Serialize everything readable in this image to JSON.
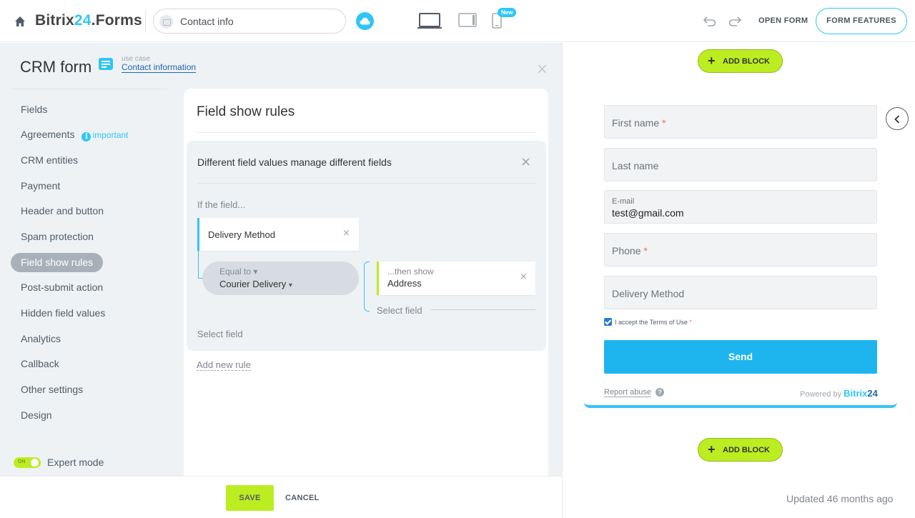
{
  "topbar": {
    "brand_main": "Bitrix",
    "brand_num": "24",
    "brand_suffix": ".Forms",
    "form_name": "Contact info",
    "new_badge": "New",
    "open_form": "OPEN FORM",
    "form_features": "FORM FEATURES"
  },
  "editor": {
    "title": "CRM form",
    "usecase_label": "use case",
    "usecase_value": "Contact information",
    "menu": [
      {
        "label": "Fields"
      },
      {
        "label": "Agreements",
        "badge": "important"
      },
      {
        "label": "CRM entities"
      },
      {
        "label": "Payment"
      },
      {
        "label": "Header and button"
      },
      {
        "label": "Spam protection"
      },
      {
        "label": "Field show rules",
        "active": true
      },
      {
        "label": "Post-submit action"
      },
      {
        "label": "Hidden field values"
      },
      {
        "label": "Analytics"
      },
      {
        "label": "Callback"
      },
      {
        "label": "Other settings"
      },
      {
        "label": "Design"
      }
    ],
    "expert_toggle_text": "ON",
    "expert_mode": "Expert mode"
  },
  "rules": {
    "title": "Field show rules",
    "rule_title": "Different field values manage different fields",
    "if_field": "If the field...",
    "field": "Delivery Method",
    "condition_label": "Equal to",
    "condition_value": "Courier Delivery",
    "then_label": "...then show",
    "then_value": "Address",
    "select_field_then": "Select field",
    "select_field": "Select field",
    "add_rule": "Add new rule"
  },
  "bottombar": {
    "save": "SAVE",
    "cancel": "CANCEL"
  },
  "preview": {
    "add_block": "ADD BLOCK",
    "fields": {
      "first_name": "First name",
      "last_name": "Last name",
      "email_label": "E-mail",
      "email_value": "test@gmail.com",
      "phone": "Phone",
      "delivery": "Delivery Method"
    },
    "required_mark": "*",
    "terms": "I accept the Terms of Use",
    "send": "Send",
    "report_abuse": "Report abuse",
    "help": "?",
    "powered_by": "Powered by",
    "powered_brand": "Bitrix",
    "powered_num": "24",
    "updated": "Updated 46 months ago"
  },
  "colors": {
    "accent": "#2fc6f6",
    "green": "#bbed21",
    "send": "#1eb5ef"
  }
}
